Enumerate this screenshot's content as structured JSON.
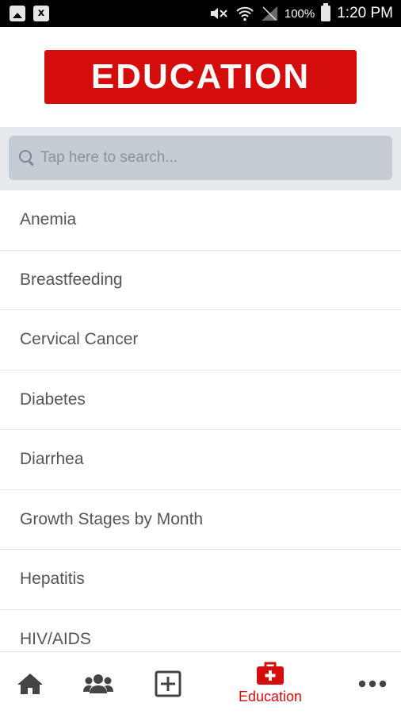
{
  "status_bar": {
    "battery_percent": "100%",
    "time": "1:20 PM",
    "icons": [
      "image-notification-icon",
      "file-notification-icon",
      "mute-icon",
      "wifi-icon",
      "signal-icon",
      "battery-icon"
    ]
  },
  "header": {
    "title": "EDUCATION",
    "color": "#d50c0c"
  },
  "search": {
    "placeholder": "Tap here to search..."
  },
  "topics": [
    "Anemia",
    "Breastfeeding",
    "Cervical Cancer",
    "Diabetes",
    "Diarrhea",
    "Growth Stages by Month",
    "Hepatitis",
    "HIV/AIDS"
  ],
  "tabbar": {
    "active_color": "#d50c0c",
    "inactive_color": "#444444",
    "tabs": [
      {
        "icon": "home-icon",
        "label": ""
      },
      {
        "icon": "users-icon",
        "label": ""
      },
      {
        "icon": "add-square-icon",
        "label": ""
      },
      {
        "icon": "medical-kit-icon",
        "label": "Education",
        "active": true
      },
      {
        "icon": "more-icon",
        "label": ""
      }
    ]
  }
}
